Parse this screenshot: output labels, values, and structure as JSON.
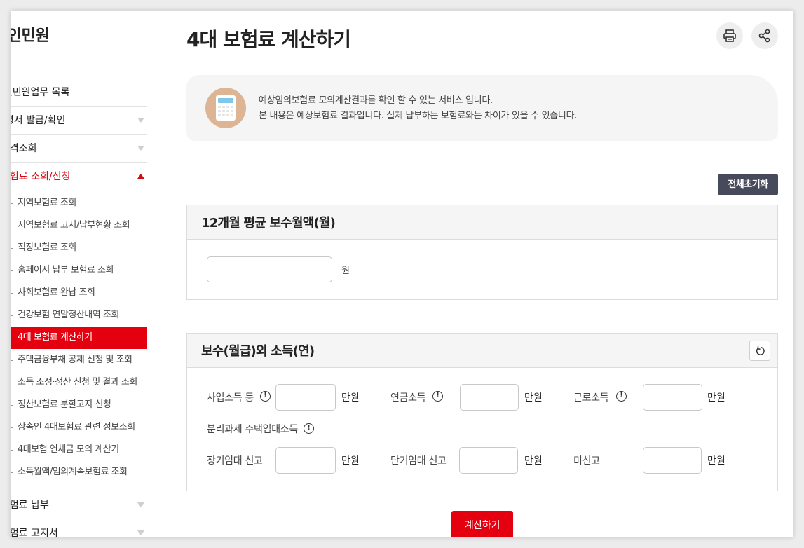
{
  "sidebar": {
    "title": "개인민원",
    "items": [
      {
        "label": "개인민원업무 목록"
      },
      {
        "label": "증명서 발급/확인"
      },
      {
        "label": "자격조회"
      },
      {
        "label": "보험료 조회/신청"
      },
      {
        "label": "보험료 납부"
      },
      {
        "label": "보험료 고지서"
      }
    ],
    "submenu": [
      "지역보험료 조회",
      "지역보험료 고지/납부현황 조회",
      "직장보험료 조회",
      "홈페이지 납부 보험료 조회",
      "사회보험료 완납 조회",
      "건강보험 연말정산내역 조회",
      "4대 보험료 계산하기",
      "주택금융부채 공제 신청 및 조회",
      "소득 조정·정산 신청 및 결과 조회",
      "정산보험료 분할고지 신청",
      "상속인 4대보험료 관련 정보조회",
      "4대보험 연체금 모의 계산기",
      "소득월액/임의계속보험료 조회"
    ]
  },
  "page": {
    "title": "4대 보험료 계산하기"
  },
  "notice": {
    "line1": "예상임의보험료 모의계산결과를 확인 할 수 있는 서비스 입니다.",
    "line2": "본 내용은 예상보험료 결과입니다. 실제 납부하는 보험료와는 차이가 있을 수 있습니다."
  },
  "reset_all_label": "전체초기화",
  "section1": {
    "title": "12개월 평균 보수월액(월)",
    "unit": "원"
  },
  "section2": {
    "title": "보수(월급)외 소득(연)",
    "business_label": "사업소득 등",
    "pension_label": "연금소득",
    "earned_label": "근로소득",
    "separate_label": "분리과세 주택임대소득",
    "long_term_label": "장기임대 신고",
    "short_term_label": "단기임대 신고",
    "unreported_label": "미신고",
    "unit": "만원"
  },
  "calc_button": "계산하기",
  "colors": {
    "accent": "#e5000f",
    "dark_button": "#474a5a",
    "notice_bg": "#f5f5f5"
  },
  "icons": [
    "print-icon",
    "share-icon",
    "calculator-icon",
    "info-icon",
    "refresh-icon"
  ]
}
